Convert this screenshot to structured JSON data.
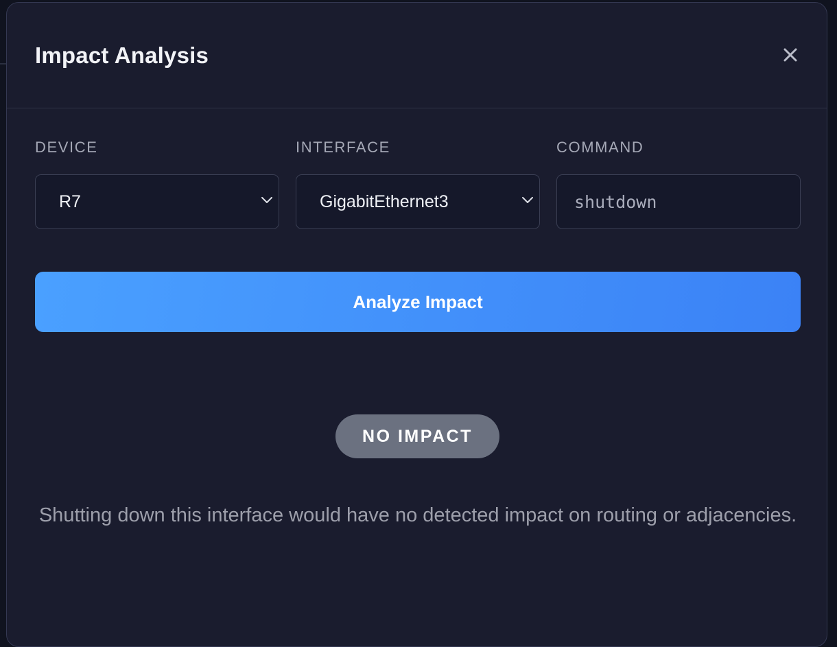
{
  "modal": {
    "title": "Impact Analysis",
    "close_icon": "close-icon"
  },
  "form": {
    "device": {
      "label": "DEVICE",
      "value": "R7"
    },
    "interface": {
      "label": "INTERFACE",
      "value": "GigabitEthernet3"
    },
    "command": {
      "label": "COMMAND",
      "placeholder": "shutdown"
    },
    "analyze_label": "Analyze Impact"
  },
  "result": {
    "badge": "NO IMPACT",
    "message": "Shutting down this interface would have no detected impact on routing or adjacencies."
  },
  "colors": {
    "accent": "#3b82f6",
    "badge": "#6b7180",
    "modal_bg": "#1a1c2e"
  }
}
